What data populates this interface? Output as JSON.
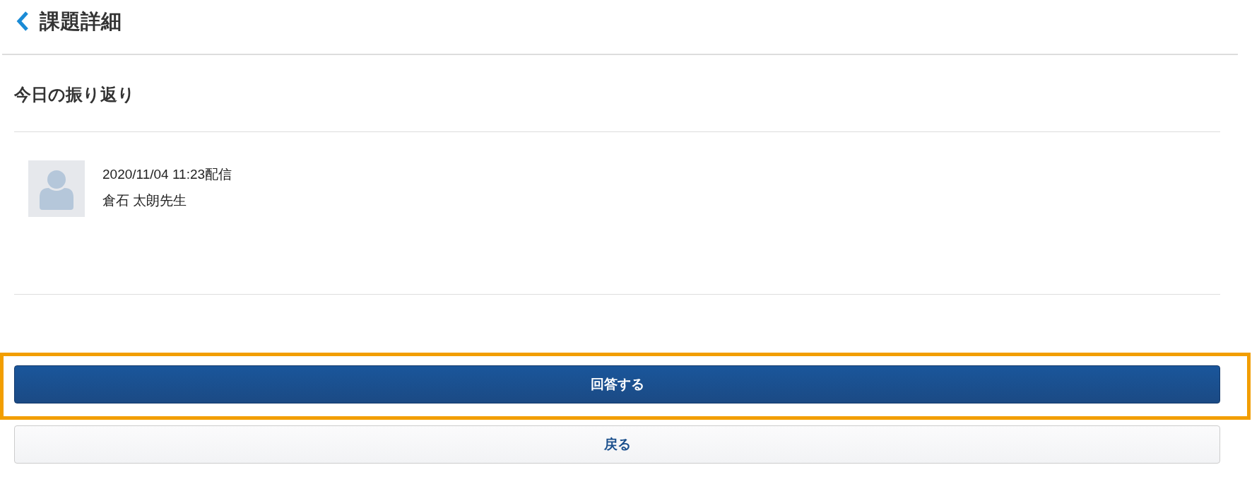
{
  "header": {
    "title": "課題詳細"
  },
  "assignment": {
    "title": "今日の振り返り",
    "posted": "2020/11/04 11:23配信",
    "teacher": "倉石 太朗先生"
  },
  "buttons": [
    {
      "label": "回答する",
      "kind": "primary",
      "highlighted": true
    },
    {
      "label": "戻る",
      "kind": "secondary",
      "highlighted": false
    }
  ]
}
